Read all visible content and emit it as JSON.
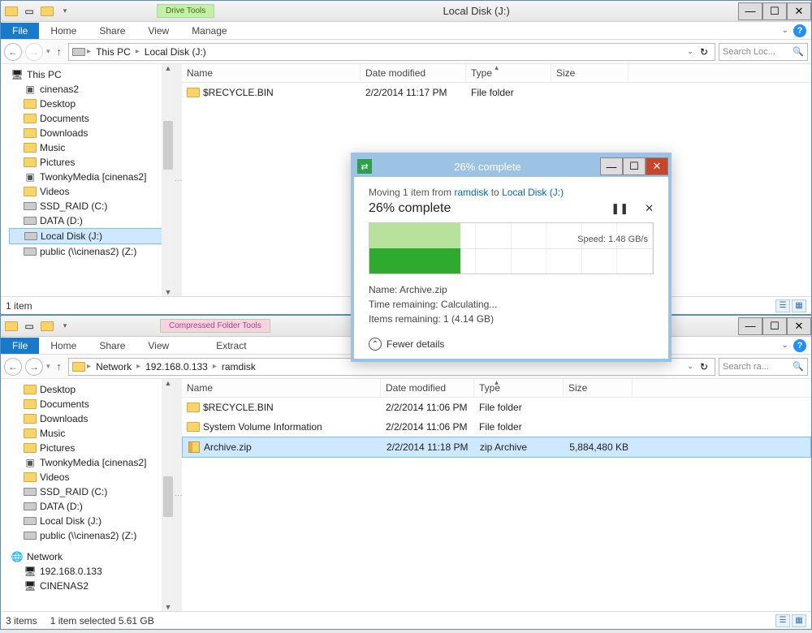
{
  "top_window": {
    "tools_tab": "Drive Tools",
    "title": "Local Disk (J:)",
    "ribbon": {
      "file": "File",
      "home": "Home",
      "share": "Share",
      "view": "View",
      "manage": "Manage"
    },
    "breadcrumb": [
      "This PC",
      "Local Disk (J:)"
    ],
    "search_placeholder": "Search Loc...",
    "columns": {
      "name": "Name",
      "date": "Date modified",
      "type": "Type",
      "size": "Size"
    },
    "rows": [
      {
        "name": "$RECYCLE.BIN",
        "date": "2/2/2014 11:17 PM",
        "type": "File folder",
        "size": "",
        "icon": "folder"
      }
    ],
    "tree": [
      {
        "label": "This PC",
        "icon": "pc",
        "root": true
      },
      {
        "label": "cinenas2",
        "icon": "server"
      },
      {
        "label": "Desktop",
        "icon": "folder"
      },
      {
        "label": "Documents",
        "icon": "folder"
      },
      {
        "label": "Downloads",
        "icon": "folder"
      },
      {
        "label": "Music",
        "icon": "folder"
      },
      {
        "label": "Pictures",
        "icon": "folder"
      },
      {
        "label": "TwonkyMedia [cinenas2]",
        "icon": "server"
      },
      {
        "label": "Videos",
        "icon": "folder"
      },
      {
        "label": "SSD_RAID (C:)",
        "icon": "drive"
      },
      {
        "label": "DATA (D:)",
        "icon": "drive"
      },
      {
        "label": "Local Disk (J:)",
        "icon": "drive",
        "selected": true
      },
      {
        "label": "public (\\\\cinenas2) (Z:)",
        "icon": "drive"
      }
    ],
    "status": "1 item"
  },
  "bottom_window": {
    "tools_tab": "Compressed Folder Tools",
    "title": "",
    "ribbon": {
      "file": "File",
      "home": "Home",
      "share": "Share",
      "view": "View",
      "extract": "Extract"
    },
    "breadcrumb": [
      "Network",
      "192.168.0.133",
      "ramdisk"
    ],
    "search_placeholder": "Search ra...",
    "columns": {
      "name": "Name",
      "date": "Date modified",
      "type": "Type",
      "size": "Size"
    },
    "rows": [
      {
        "name": "$RECYCLE.BIN",
        "date": "2/2/2014 11:06 PM",
        "type": "File folder",
        "size": "",
        "icon": "folder"
      },
      {
        "name": "System Volume Information",
        "date": "2/2/2014 11:06 PM",
        "type": "File folder",
        "size": "",
        "icon": "folder"
      },
      {
        "name": "Archive.zip",
        "date": "2/2/2014 11:18 PM",
        "type": "zip Archive",
        "size": "5,884,480 KB",
        "icon": "zip",
        "selected": true
      }
    ],
    "tree": [
      {
        "label": "Desktop",
        "icon": "folder"
      },
      {
        "label": "Documents",
        "icon": "folder"
      },
      {
        "label": "Downloads",
        "icon": "folder"
      },
      {
        "label": "Music",
        "icon": "folder"
      },
      {
        "label": "Pictures",
        "icon": "folder"
      },
      {
        "label": "TwonkyMedia [cinenas2]",
        "icon": "server"
      },
      {
        "label": "Videos",
        "icon": "folder"
      },
      {
        "label": "SSD_RAID (C:)",
        "icon": "drive"
      },
      {
        "label": "DATA (D:)",
        "icon": "drive"
      },
      {
        "label": "Local Disk (J:)",
        "icon": "drive"
      },
      {
        "label": "public (\\\\cinenas2) (Z:)",
        "icon": "drive"
      },
      {
        "label": "",
        "icon": ""
      },
      {
        "label": "Network",
        "icon": "net",
        "root": true
      },
      {
        "label": "192.168.0.133",
        "icon": "pc"
      },
      {
        "label": "CINENAS2",
        "icon": "pc"
      }
    ],
    "status_items": "3 items",
    "status_sel": "1 item selected  5.61 GB"
  },
  "copy_dialog": {
    "title_percent": "26% complete",
    "moving_prefix": "Moving 1 item from ",
    "moving_src": "ramdisk",
    "moving_mid": " to ",
    "moving_dst": "Local Disk (J:)",
    "percent_headline": "26% complete",
    "speed_label": "Speed: 1.48 GB/s",
    "progress_percent": 32,
    "name_line": "Name: Archive.zip",
    "time_line": "Time remaining: Calculating...",
    "items_line": "Items remaining: 1 (4.14 GB)",
    "fewer": "Fewer details",
    "pause_icon": "❚❚",
    "cancel_icon": "✕"
  }
}
